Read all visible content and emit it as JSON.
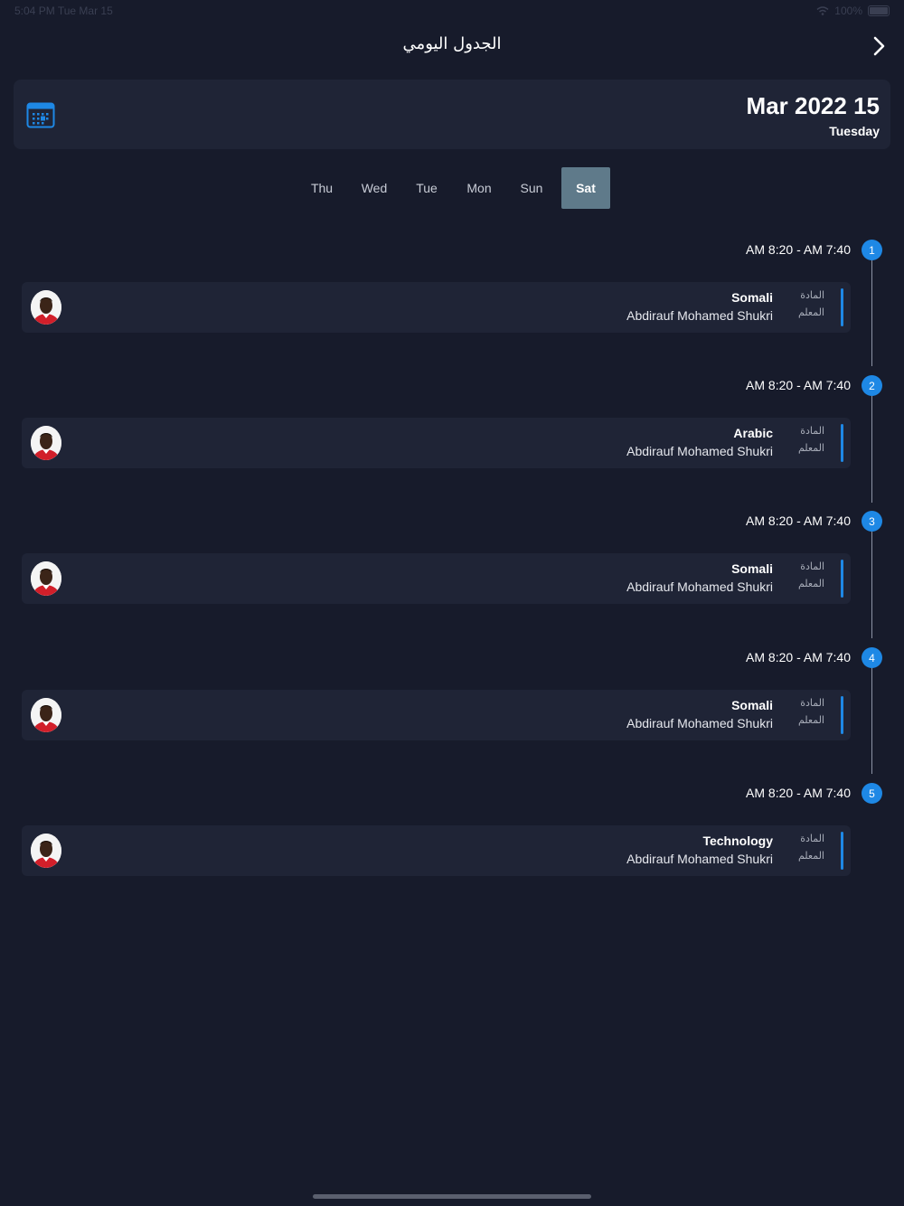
{
  "status_bar": {
    "time": "5:04 PM",
    "date": "Tue Mar 15",
    "battery": "100%"
  },
  "header": {
    "title": "الجدول اليومي"
  },
  "date_card": {
    "date": "Mar 2022 15",
    "weekday": "Tuesday"
  },
  "tabs": [
    {
      "label": "Thu"
    },
    {
      "label": "Wed"
    },
    {
      "label": "Tue"
    },
    {
      "label": "Mon"
    },
    {
      "label": "Sun"
    },
    {
      "label": "Sat"
    }
  ],
  "active_tab": "Sat",
  "labels": {
    "subject": "المادة",
    "teacher": "المعلم"
  },
  "periods": [
    {
      "number": "1",
      "time": "AM 8:20 - AM 7:40",
      "subject": "Somali",
      "teacher": "Abdirauf Mohamed Shukri"
    },
    {
      "number": "2",
      "time": "AM 8:20 - AM 7:40",
      "subject": "Arabic",
      "teacher": "Abdirauf Mohamed Shukri"
    },
    {
      "number": "3",
      "time": "AM 8:20 - AM 7:40",
      "subject": "Somali",
      "teacher": "Abdirauf Mohamed Shukri"
    },
    {
      "number": "4",
      "time": "AM 8:20 - AM 7:40",
      "subject": "Somali",
      "teacher": "Abdirauf Mohamed Shukri"
    },
    {
      "number": "5",
      "time": "AM 8:20 - AM 7:40",
      "subject": "Technology",
      "teacher": "Abdirauf Mohamed Shukri"
    }
  ],
  "colors": {
    "background": "#171b2b",
    "card": "#1f2436",
    "accent": "#1e88e5",
    "active_tab": "#5f7a8a"
  }
}
